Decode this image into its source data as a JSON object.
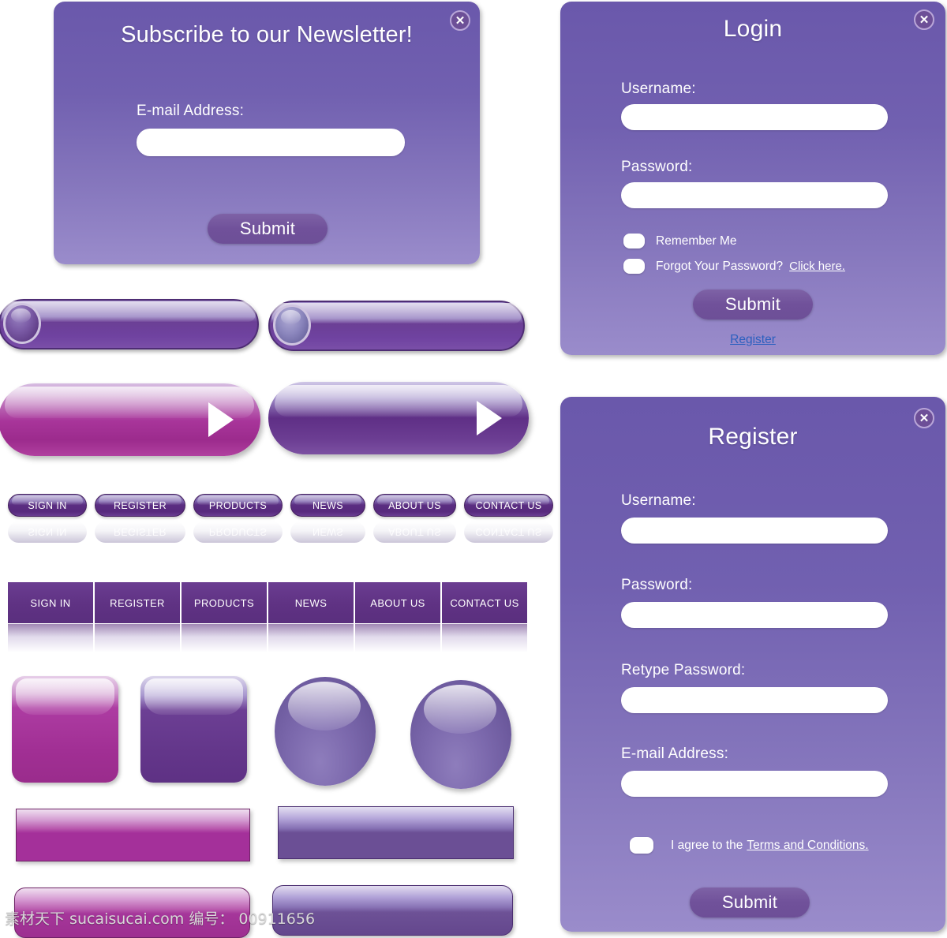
{
  "newsletter": {
    "title": "Subscribe to our Newsletter!",
    "email_label": "E-mail Address:",
    "email_value": "",
    "email_placeholder": "",
    "submit_label": "Submit",
    "close_icon": "close-icon",
    "close_glyph": "✕"
  },
  "login": {
    "title": "Login",
    "username_label": "Username:",
    "username_value": "",
    "password_label": "Password:",
    "password_value": "",
    "remember_label": "Remember Me",
    "forgot_label": "Forgot Your Password?",
    "forgot_link": "Click here.",
    "submit_label": "Submit",
    "register_link": "Register",
    "close_glyph": "✕"
  },
  "register": {
    "title": "Register",
    "username_label": "Username:",
    "username_value": "",
    "password_label": "Password:",
    "password_value": "",
    "retype_label": "Retype Password:",
    "retype_value": "",
    "email_label": "E-mail Address:",
    "email_value": "",
    "agree_label": "I agree to the",
    "agree_link": "Terms and Conditions.",
    "submit_label": "Submit",
    "close_glyph": "✕"
  },
  "nav_buttons": [
    {
      "label": "SIGN IN"
    },
    {
      "label": "REGISTER"
    },
    {
      "label": "PRODUCTS"
    },
    {
      "label": "NEWS"
    },
    {
      "label": "ABOUT US"
    },
    {
      "label": "CONTACT US"
    }
  ],
  "menu_bar": [
    {
      "label": "SIGN IN"
    },
    {
      "label": "REGISTER"
    },
    {
      "label": "PRODUCTS"
    },
    {
      "label": "NEWS"
    },
    {
      "label": "ABOUT US"
    },
    {
      "label": "CONTACT US"
    }
  ],
  "watermark": "素材天下 sucaisucai.com  编号： 00911656",
  "colors": {
    "panel_top": "#6a58ab",
    "panel_bottom": "#9a8ccb",
    "submit": "#6d4f97",
    "link": "#2b5fbf",
    "magenta": "#a4309a",
    "deep_purple": "#5a2f7e",
    "white": "#ffffff"
  }
}
